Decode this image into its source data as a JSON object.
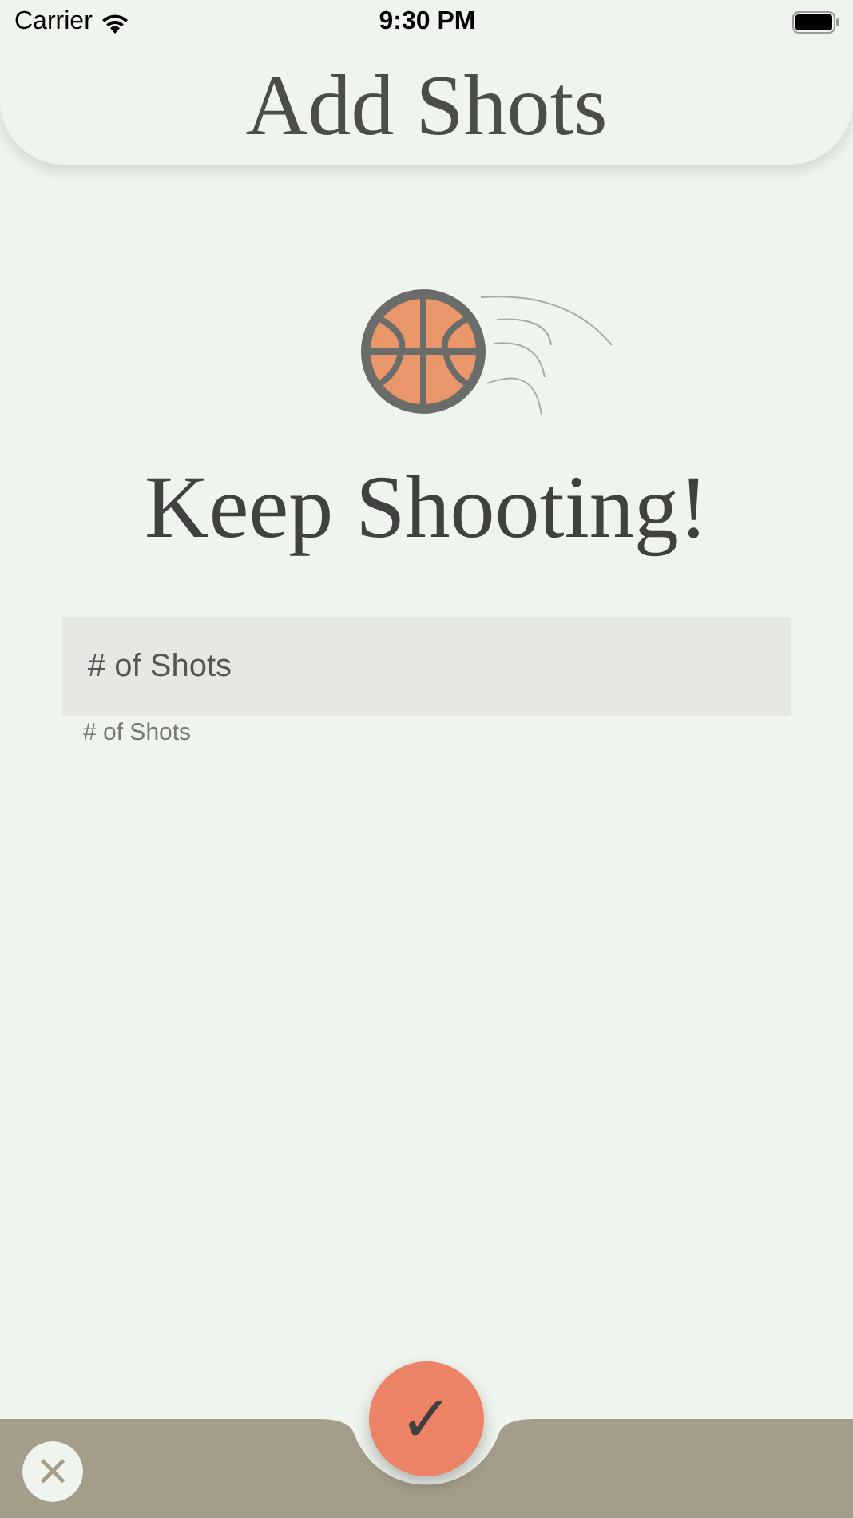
{
  "status_bar": {
    "carrier": "Carrier",
    "time": "9:30 PM"
  },
  "header": {
    "title": "Add Shots"
  },
  "headline": "Keep Shooting!",
  "shots_field": {
    "placeholder": "# of Shots",
    "helper": "# of Shots"
  },
  "bottom_bar": {
    "close": "×",
    "confirm": "✓"
  }
}
